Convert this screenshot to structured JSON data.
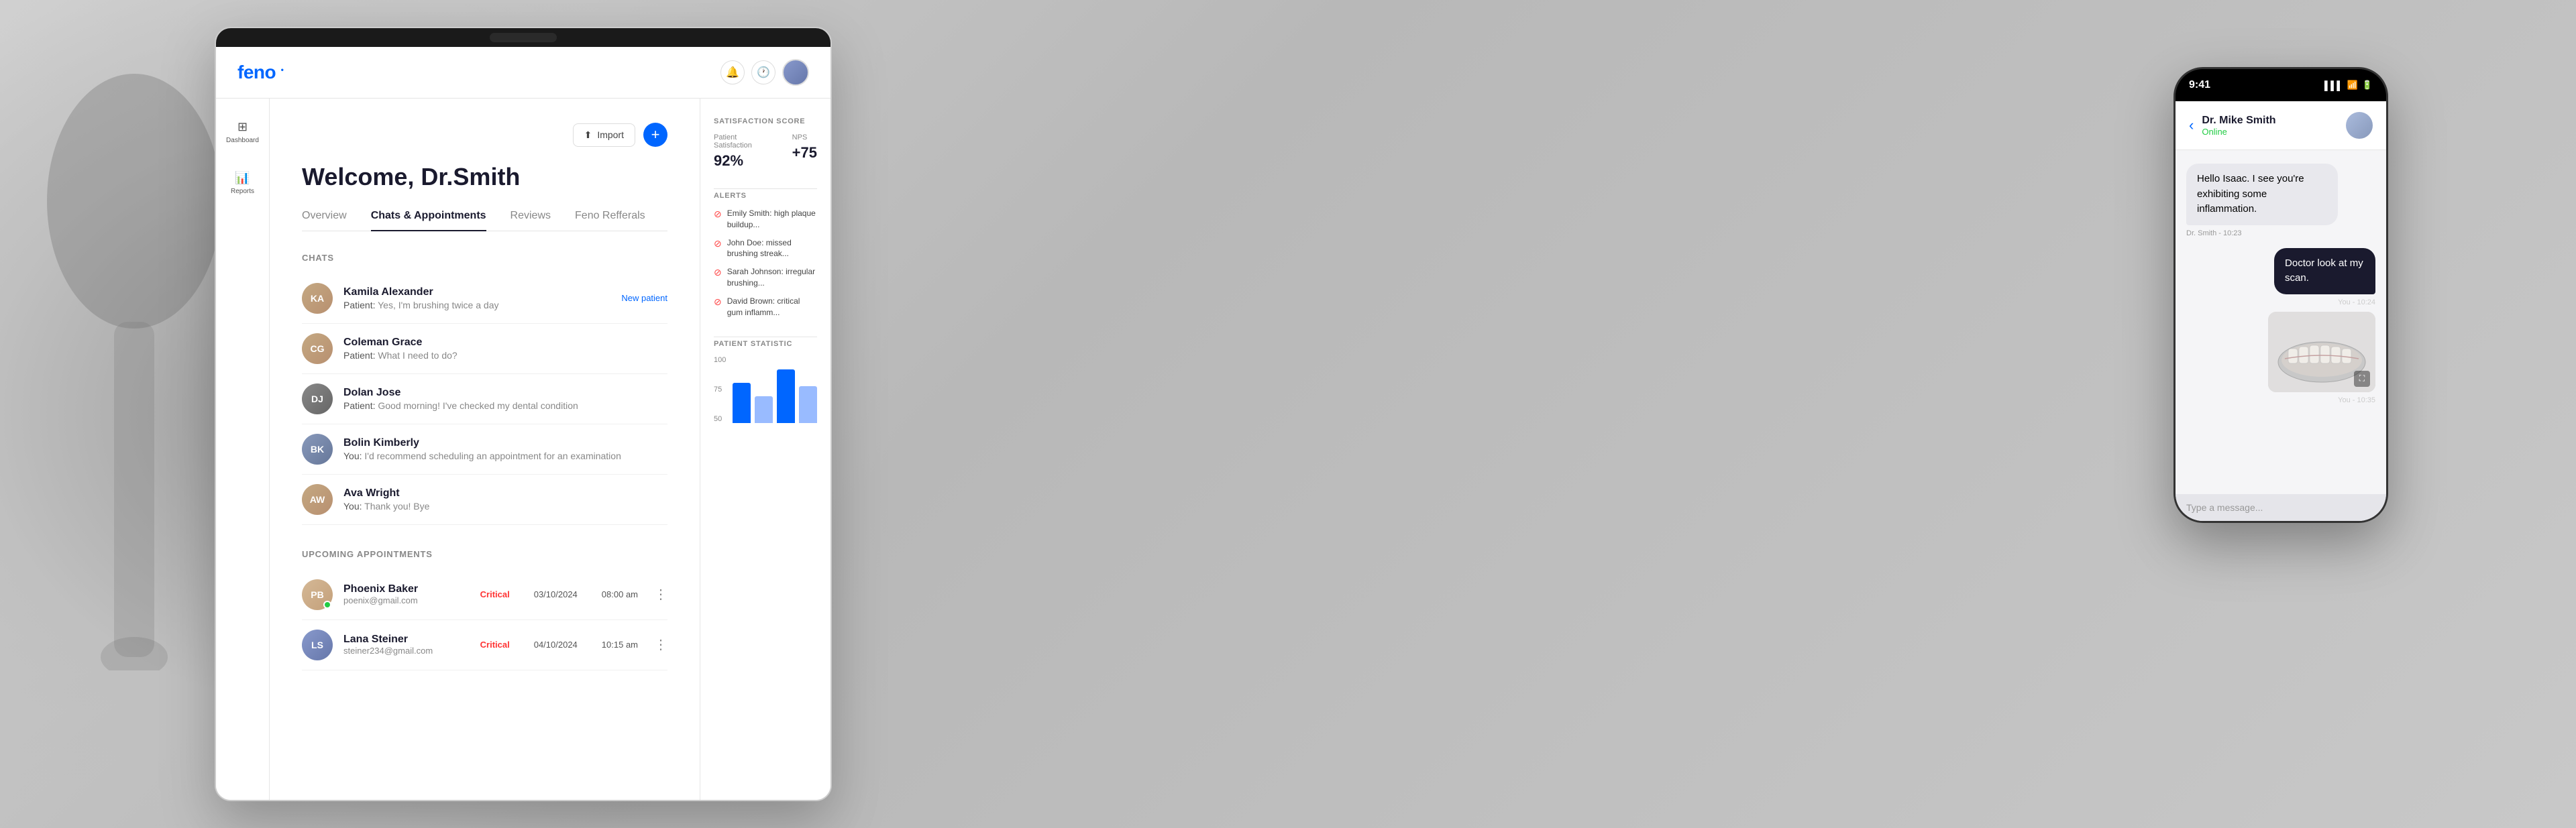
{
  "background": {
    "color": "#ddd"
  },
  "app": {
    "logo": "feno",
    "header": {
      "import_label": "Import",
      "add_label": "+",
      "notification_icon": "🔔",
      "clock_icon": "🕐"
    },
    "sidebar": {
      "items": [
        {
          "icon": "⊞",
          "label": "Dashboard"
        },
        {
          "icon": "📊",
          "label": "Reports"
        }
      ]
    },
    "welcome_title": "Welcome, Dr.Smith",
    "tabs": [
      {
        "label": "Overview",
        "active": false
      },
      {
        "label": "Chats & Appointments",
        "active": true
      },
      {
        "label": "Reviews",
        "active": false
      },
      {
        "label": "Feno Refferals",
        "active": false
      }
    ],
    "chats_section_label": "CHATS",
    "chats": [
      {
        "name": "Kamila Alexander",
        "preview_sender": "Patient:",
        "preview_text": "Yes, I'm brushing twice a day",
        "badge": "New patient",
        "av": "av1"
      },
      {
        "name": "Coleman Grace",
        "preview_sender": "Patient:",
        "preview_text": "What I need to do?",
        "badge": "",
        "av": "av2"
      },
      {
        "name": "Dolan Jose",
        "preview_sender": "Patient:",
        "preview_text": "Good morning! I've checked my dental condition",
        "badge": "",
        "av": "av3"
      },
      {
        "name": "Bolin Kimberly",
        "preview_sender": "You:",
        "preview_text": "I'd recommend scheduling an appointment for an examination",
        "badge": "",
        "av": "av4"
      },
      {
        "name": "Ava Wright",
        "preview_sender": "You:",
        "preview_text": "Thank you! Bye",
        "badge": "",
        "av": "av5"
      }
    ],
    "appointments_section_label": "UPCOMING APPOINTMENTS",
    "appointments": [
      {
        "name": "Phoenix Baker",
        "email": "poenix@gmail.com",
        "status": "Critical",
        "date": "03/10/2024",
        "time": "08:00 am",
        "av": "av1",
        "has_dot": true
      },
      {
        "name": "Lana Steiner",
        "email": "steiner234@gmail.com",
        "status": "Critical",
        "date": "04/10/2024",
        "time": "10:15 am",
        "av": "av2",
        "has_dot": false
      }
    ]
  },
  "right_panel": {
    "satisfaction_title": "SATISFACTION SCORE",
    "patient_satisfaction_label": "Patient Satisfaction",
    "patient_satisfaction_value": "92%",
    "nps_label": "NPS",
    "nps_value": "+75",
    "alerts_title": "ALERTS",
    "alerts": [
      {
        "text": "Emily Smith: high plaque buildup..."
      },
      {
        "text": "John Doe: missed brushing streak..."
      },
      {
        "text": "Sarah Johnson: irregular brushing..."
      },
      {
        "text": "David Brown: critical gum inflamm..."
      }
    ],
    "patient_statistic_title": "PATIENT STATISTIC",
    "chart_labels": [
      "100",
      "75",
      "50"
    ],
    "chart_bars": [
      {
        "height": 60,
        "type": "blue"
      },
      {
        "height": 40,
        "type": "light-blue"
      },
      {
        "height": 80,
        "type": "blue"
      },
      {
        "height": 55,
        "type": "light-blue"
      }
    ]
  },
  "phone": {
    "time": "9:41",
    "contact_name": "Dr. Mike Smith",
    "contact_status": "Online",
    "messages": [
      {
        "type": "received",
        "text": "Hello Isaac. I see you're exhibiting some inflammation.",
        "time": "Dr. Smith - 10:23"
      },
      {
        "type": "sent",
        "text": "Doctor look at my scan.",
        "time": "You - 10:24",
        "has_scan": true
      }
    ],
    "last_time_label": "You - 10:35"
  }
}
